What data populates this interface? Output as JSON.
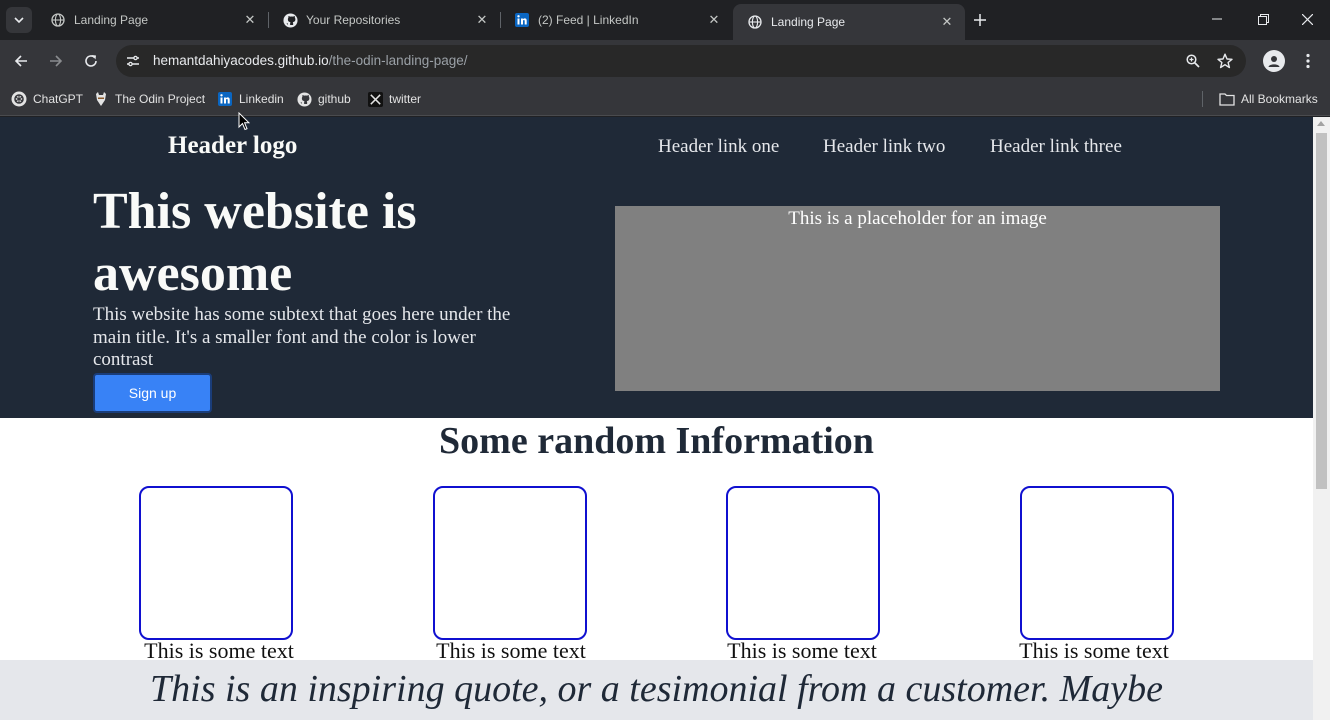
{
  "browser": {
    "tabs": [
      {
        "title": "Landing Page",
        "icon": "globe-icon",
        "active": false
      },
      {
        "title": "Your Repositories",
        "icon": "github-icon",
        "active": false
      },
      {
        "title": "(2) Feed | LinkedIn",
        "icon": "linkedin-icon",
        "active": false
      },
      {
        "title": "Landing Page",
        "icon": "globe-icon",
        "active": true
      }
    ],
    "url_host": "hemantdahiyacodes.github.io",
    "url_path": "/the-odin-landing-page/",
    "bookmarks": [
      {
        "label": "ChatGPT",
        "icon": "chatgpt-icon"
      },
      {
        "label": "The Odin Project",
        "icon": "odin-icon"
      },
      {
        "label": "Linkedin",
        "icon": "linkedin-icon"
      },
      {
        "label": "github",
        "icon": "github-icon"
      },
      {
        "label": "twitter",
        "icon": "x-icon"
      }
    ],
    "all_bookmarks_label": "All Bookmarks"
  },
  "page": {
    "header": {
      "logo": "Header logo",
      "links": [
        "Header link one",
        "Header link two",
        "Header link three"
      ]
    },
    "hero": {
      "title": "This website is awesome",
      "subtext": "This website has some subtext that goes here under the main title. It's a smaller font and the color is lower contrast",
      "signup_label": "Sign up",
      "image_placeholder": "This is a placeholder for an image"
    },
    "info": {
      "title": "Some random Information",
      "cards": [
        {
          "text": "This is some text"
        },
        {
          "text": "This is some text"
        },
        {
          "text": "This is some text"
        },
        {
          "text": "This is some text"
        }
      ]
    },
    "quote": "This is an inspiring quote, or a tesimonial from a customer. Maybe"
  },
  "colors": {
    "hero_bg": "#1f2937",
    "button_blue": "#3882f6",
    "card_border": "#1010d0",
    "placeholder_gray": "#808080",
    "quote_band": "#e5e7eb"
  }
}
